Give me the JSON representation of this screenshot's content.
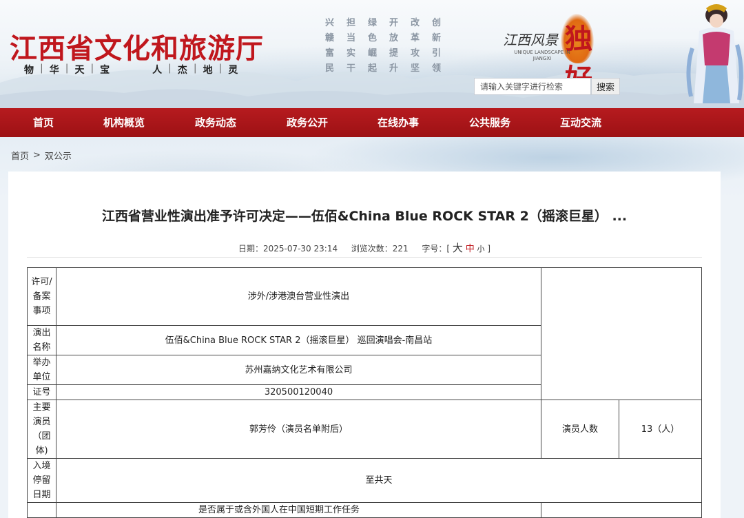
{
  "header": {
    "site_title": "江西省文化和旅游厅",
    "motto": [
      "物",
      "华",
      "天",
      "宝",
      "人",
      "杰",
      "地",
      "灵"
    ],
    "poem": [
      "兴",
      "担",
      "绿",
      "开",
      "改",
      "创",
      "赣",
      "当",
      "色",
      "放",
      "革",
      "新",
      "富",
      "实",
      "崛",
      "提",
      "攻",
      "引",
      "民",
      "干",
      "起",
      "升",
      "坚",
      "领"
    ],
    "logo_cn": "江西风景",
    "logo_char": "独好",
    "logo_en": "UNIQUE LANDSCAPE IN JIANGXI",
    "search": {
      "placeholder": "请输入关键字进行检索",
      "button_label": "搜索"
    }
  },
  "nav": {
    "items": [
      "首页",
      "机构概览",
      "政务动态",
      "政务公开",
      "在线办事",
      "公共服务",
      "互动交流"
    ]
  },
  "breadcrumb": {
    "home": "首页",
    "separator": ">",
    "current": "双公示"
  },
  "article": {
    "title": "江西省营业性演出准予许可决定——伍佰&China Blue ROCK STAR 2（摇滚巨星） ...",
    "meta": {
      "date_label": "日期：",
      "date": "2025-07-30 23:14",
      "views_label": "浏览次数：",
      "views": "221",
      "font_label": "字号：[",
      "font_big": "大",
      "font_mid": "中",
      "font_small": "小",
      "font_close": "]"
    }
  },
  "table": {
    "item_label": "许可/备案事项",
    "item_value": "涉外/涉港澳台营业性演出",
    "show_label": "演出名称",
    "show_value": "伍佰&China Blue ROCK STAR 2（摇滚巨星） 巡回演唱会-南昌站",
    "host_label": "举办单位",
    "host_value": "苏州嘉纳文化艺术有限公司",
    "cert_label": "证号",
    "cert_value": "320500120040",
    "actors_label": "主要演员（团体)",
    "actors_value": "郭芳伶（演员名单附后）",
    "count_label": "演员人数",
    "count_value": "13（人）",
    "stay_label": "入境停留日期",
    "stay_value": "至共天",
    "foreign_question": "是否属于或含外国人在中国短期工作任务"
  }
}
